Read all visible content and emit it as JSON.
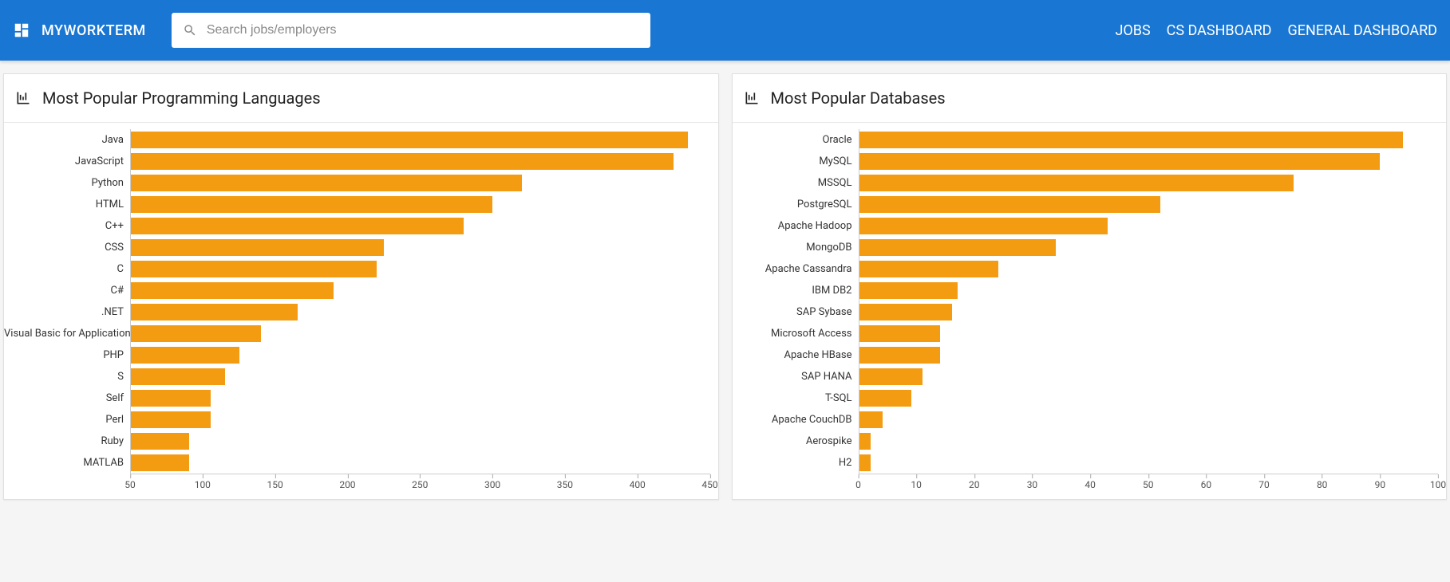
{
  "header": {
    "brand": "MYWORKTERM",
    "search_placeholder": "Search jobs/employers",
    "nav": {
      "jobs": "JOBS",
      "cs_dashboard": "CS DASHBOARD",
      "general_dashboard": "GENERAL DASHBOARD"
    }
  },
  "cards": {
    "languages_title": "Most Popular Programming Languages",
    "databases_title": "Most Popular Databases"
  },
  "chart_data": [
    {
      "type": "bar",
      "orientation": "horizontal",
      "title": "Most Popular Programming Languages",
      "categories": [
        "Java",
        "JavaScript",
        "Python",
        "HTML",
        "C++",
        "CSS",
        "C",
        "C#",
        ".NET",
        "Visual Basic for Applications",
        "PHP",
        "S",
        "Self",
        "Perl",
        "Ruby",
        "MATLAB"
      ],
      "values": [
        435,
        425,
        320,
        300,
        280,
        225,
        220,
        190,
        165,
        140,
        125,
        115,
        105,
        105,
        90,
        90
      ],
      "xlim": [
        50,
        450
      ],
      "x_ticks": [
        50,
        100,
        150,
        200,
        250,
        300,
        350,
        400,
        450
      ],
      "xlabel": "",
      "ylabel": "",
      "bar_color": "#f39c12"
    },
    {
      "type": "bar",
      "orientation": "horizontal",
      "title": "Most Popular Databases",
      "categories": [
        "Oracle",
        "MySQL",
        "MSSQL",
        "PostgreSQL",
        "Apache Hadoop",
        "MongoDB",
        "Apache Cassandra",
        "IBM DB2",
        "SAP Sybase",
        "Microsoft Access",
        "Apache HBase",
        "SAP HANA",
        "T-SQL",
        "Apache CouchDB",
        "Aerospike",
        "H2"
      ],
      "values": [
        94,
        90,
        75,
        52,
        43,
        34,
        24,
        17,
        16,
        14,
        14,
        11,
        9,
        4,
        2,
        2
      ],
      "xlim": [
        0,
        100
      ],
      "x_ticks": [
        0,
        10,
        20,
        30,
        40,
        50,
        60,
        70,
        80,
        90,
        100
      ],
      "xlabel": "",
      "ylabel": "",
      "bar_color": "#f39c12"
    }
  ]
}
